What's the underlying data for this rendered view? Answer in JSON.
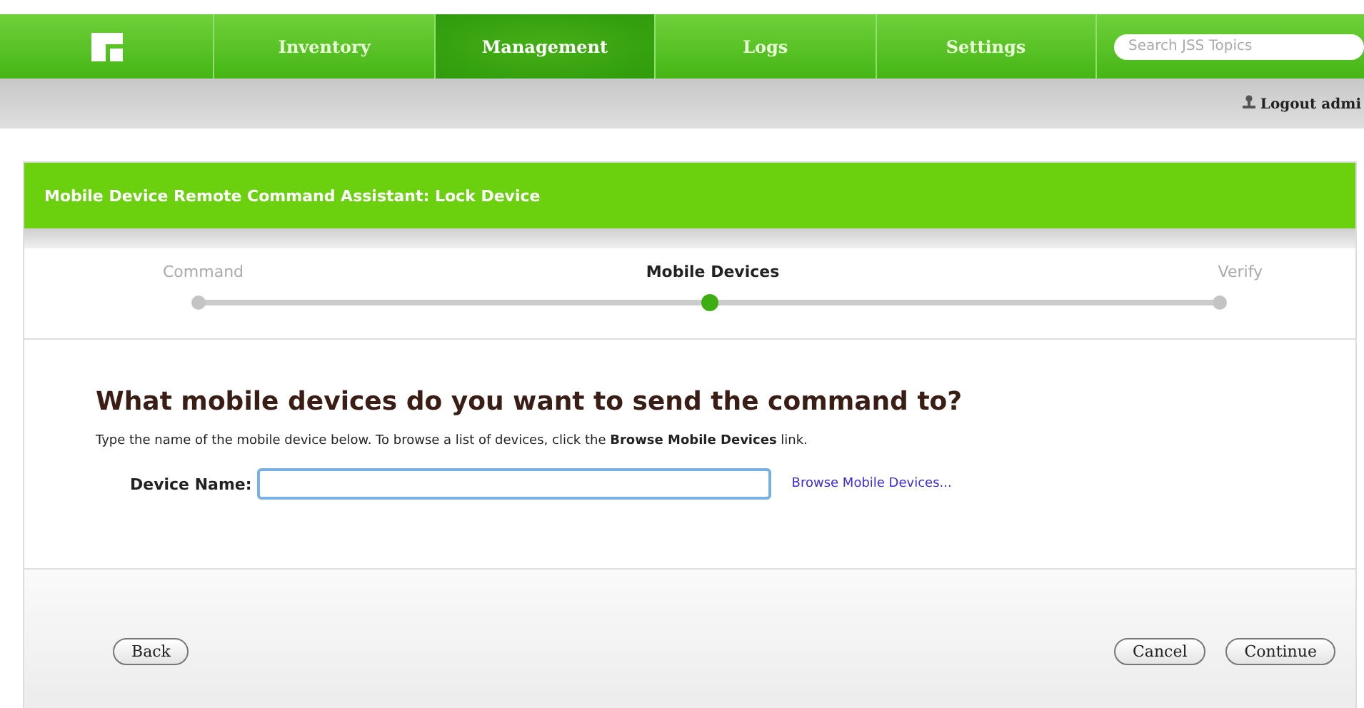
{
  "nav": {
    "tabs": [
      {
        "label": "Inventory",
        "selected": false
      },
      {
        "label": "Management",
        "selected": true
      },
      {
        "label": "Logs",
        "selected": false
      },
      {
        "label": "Settings",
        "selected": false
      }
    ],
    "search": {
      "placeholder": "Search JSS Topics"
    }
  },
  "user_bar": {
    "logout": "Logout admi"
  },
  "panel": {
    "title": "Mobile Device Remote Command Assistant: Lock Device",
    "steps": [
      {
        "label": "Command",
        "selected": false
      },
      {
        "label": "Mobile Devices",
        "selected": true
      },
      {
        "label": "Verify",
        "selected": false
      }
    ],
    "heading": "What mobile devices do you want to send the command to?",
    "instructions": "Type the name of the mobile device below. To browse a list of devices, click the **Browse Mobile Devices** link.",
    "field": {
      "label": "Device Name:"
    },
    "browse_link": "Browse Mobile Devices...",
    "buttons": {
      "back": "Back",
      "cancel": "Cancel",
      "continue": "Continue"
    }
  }
}
